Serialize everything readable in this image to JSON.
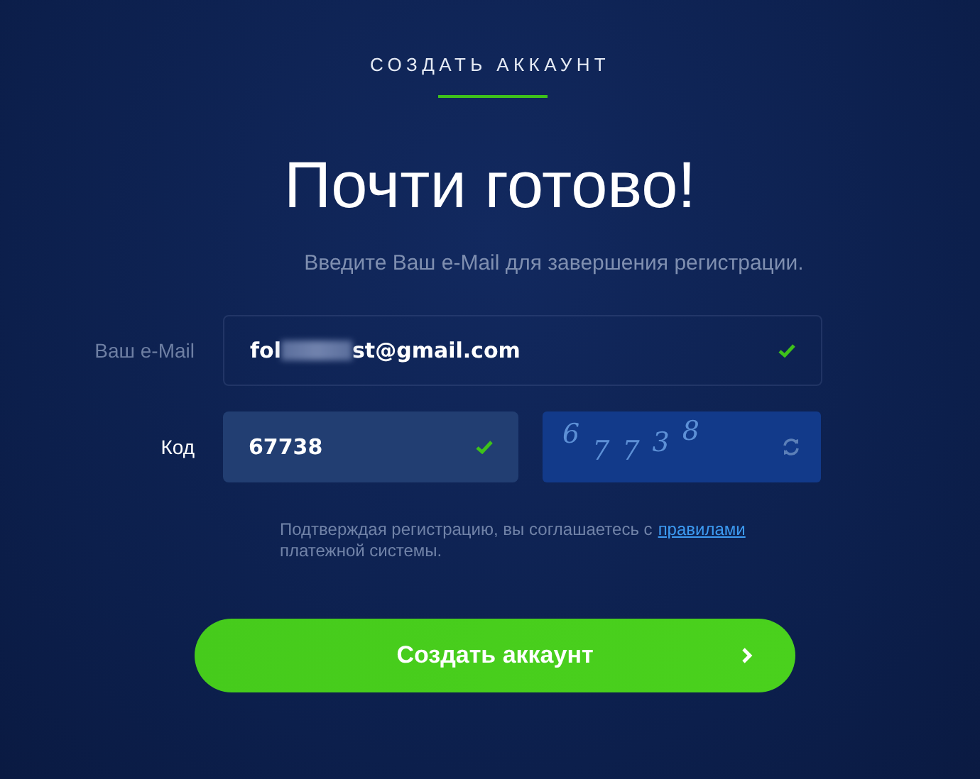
{
  "header": {
    "tab": "СОЗДАТЬ АККАУНТ",
    "selected": true
  },
  "title": "Почти готово!",
  "subtitle": "Введите Ваш e-Mail для завершения регистрации.",
  "email": {
    "label": "Ваш e-Mail",
    "value_start": "fol",
    "value_end": "st@gmail.com",
    "valid": true
  },
  "code": {
    "label": "Код",
    "value": "67738",
    "valid": true
  },
  "captcha": {
    "digits": [
      "6",
      "7",
      "7",
      "3",
      "8"
    ]
  },
  "note": {
    "text": "Подтверждая регистрацию, вы соглашаетесь с",
    "link": "правилами",
    "text_end": "платежной системы."
  },
  "submit": {
    "label": "Создать аккаунт"
  }
}
